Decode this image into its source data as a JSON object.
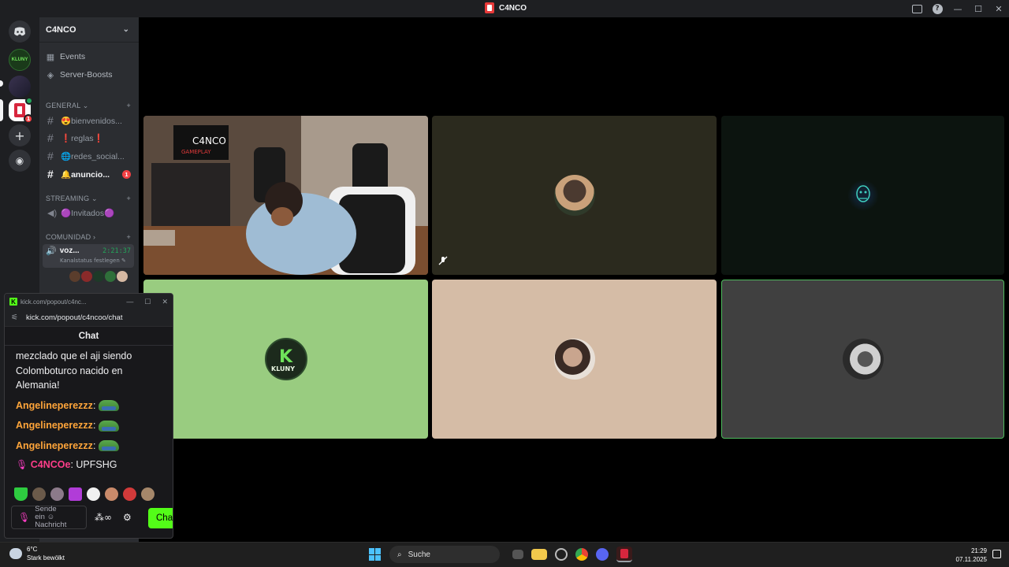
{
  "window": {
    "title": "C4NCO"
  },
  "server_list": {
    "kluny_label": "KLUNY",
    "c4nco_badge": "1"
  },
  "sidebar": {
    "guild_name": "C4NCO",
    "nav": [
      {
        "label": "Events",
        "icon": "calendar-icon"
      },
      {
        "label": "Server-Boosts",
        "icon": "boost-icon"
      }
    ],
    "categories": [
      {
        "label": "GENERAL ⌄"
      },
      {
        "label": "STREAMING ⌄"
      },
      {
        "label": "COMUNIDAD ›"
      }
    ],
    "channels": [
      {
        "label": "😍bienvenidos..."
      },
      {
        "label": "❗reglas❗"
      },
      {
        "label": "🌐redes_social..."
      },
      {
        "label": "🔔anuncio...",
        "mentions": "1"
      }
    ],
    "streaming_channel": "🟣Invitados🟣",
    "active_voice": {
      "name": "voz...",
      "timer": "2:21:37",
      "status": "Kanalstatus festlegen"
    }
  },
  "popout": {
    "tab_title": "kick.com/popout/c4nc...",
    "url": "kick.com/popout/c4ncoo/chat",
    "header": "Chat",
    "first_message": "mezclado que el aji siendo Colombo­turco nacido en Alemania!",
    "first_message_lines": [
      "mezclado que el aji siendo",
      "Colomboturco nacido en",
      "Alemania!"
    ],
    "messages": [
      {
        "user": "Angelineperezzz",
        "sep": ":"
      },
      {
        "user": "Angelineperezzz",
        "sep": ":"
      },
      {
        "user": "Angelineperezzz",
        "sep": ":"
      }
    ],
    "last_message": {
      "user": "C4NCOe",
      "text": ": UPFSHG"
    },
    "input_placeholder_lines": [
      "Sende",
      "ein",
      "Nachricht"
    ],
    "chat_button": "Chat"
  },
  "taskbar": {
    "weather_temp": "6°C",
    "weather_desc": "Stark bewölkt",
    "search_label": "Suche",
    "time": "21:29",
    "date": "07.11.2025"
  },
  "colors": {
    "kick_green": "#53fc18",
    "discord_bg": "#2b2d31",
    "username_orange": "#ffa53a",
    "tile_green": "#99cc80",
    "tile_beige": "#d5bca6"
  }
}
